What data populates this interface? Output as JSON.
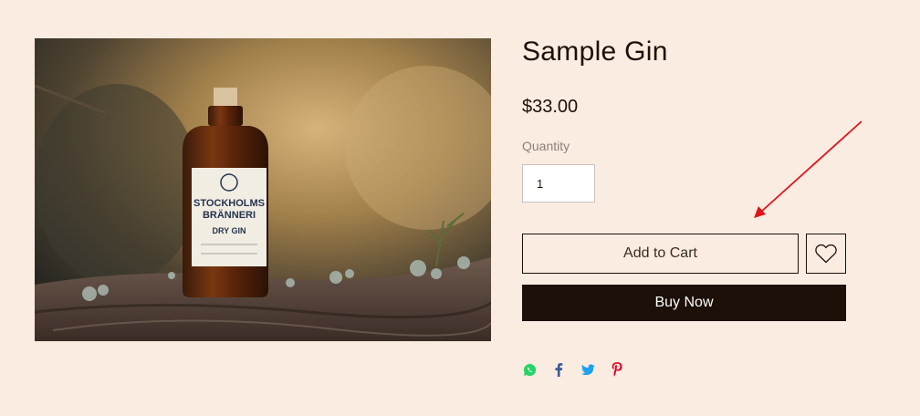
{
  "product": {
    "title": "Sample Gin",
    "price": "$33.00",
    "image_alt": "Stockholms Bränneri Dry Gin bottle on a mossy log"
  },
  "bottle_label": {
    "brand_line1": "STOCKHOLMS",
    "brand_line2": "BRÄNNERI",
    "type": "DRY GIN"
  },
  "quantity": {
    "label": "Quantity",
    "value": "1"
  },
  "buttons": {
    "add_to_cart": "Add to Cart",
    "buy_now": "Buy Now",
    "wishlist_icon": "heart-icon"
  },
  "share_icons": [
    "whatsapp-icon",
    "facebook-icon",
    "twitter-icon",
    "pinterest-icon"
  ],
  "colors": {
    "background": "#fbece1",
    "primary": "#1d1008",
    "annotation_arrow": "#e0151b",
    "whatsapp": "#25d366",
    "facebook": "#3b5998",
    "twitter": "#1da1f2",
    "pinterest": "#e60023"
  }
}
